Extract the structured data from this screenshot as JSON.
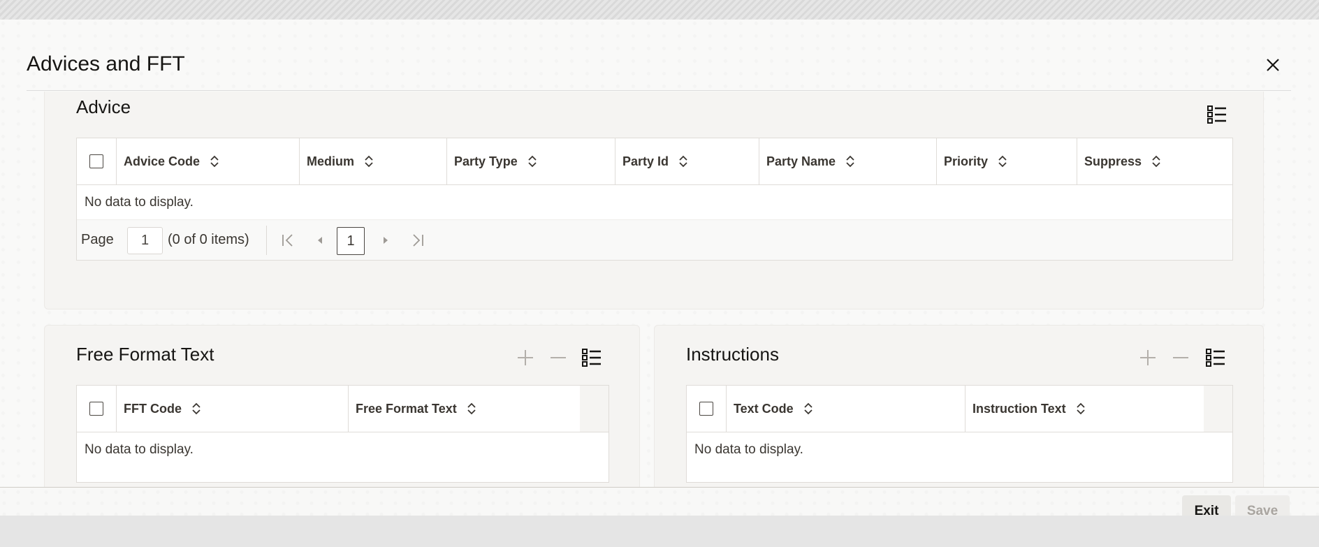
{
  "dialog": {
    "title": "Advices and FFT",
    "close_icon": "close-icon"
  },
  "advice": {
    "title": "Advice",
    "columns": [
      "Advice Code",
      "Medium",
      "Party Type",
      "Party Id",
      "Party Name",
      "Priority",
      "Suppress"
    ],
    "no_data": "No data to display.",
    "pager": {
      "page_label": "Page",
      "page_value": "1",
      "items_info": "(0 of 0 items)",
      "current_page": "1"
    }
  },
  "fft": {
    "title": "Free Format Text",
    "columns": [
      "FFT Code",
      "Free Format Text"
    ],
    "no_data": "No data to display."
  },
  "instructions": {
    "title": "Instructions",
    "columns": [
      "Text Code",
      "Instruction Text"
    ],
    "no_data": "No data to display."
  },
  "footer": {
    "exit_label": "Exit",
    "save_label": "Save"
  },
  "colors": {
    "panel_bg": "#f5f4f2",
    "text": "#161513",
    "disabled_text": "#a9a5a0"
  }
}
